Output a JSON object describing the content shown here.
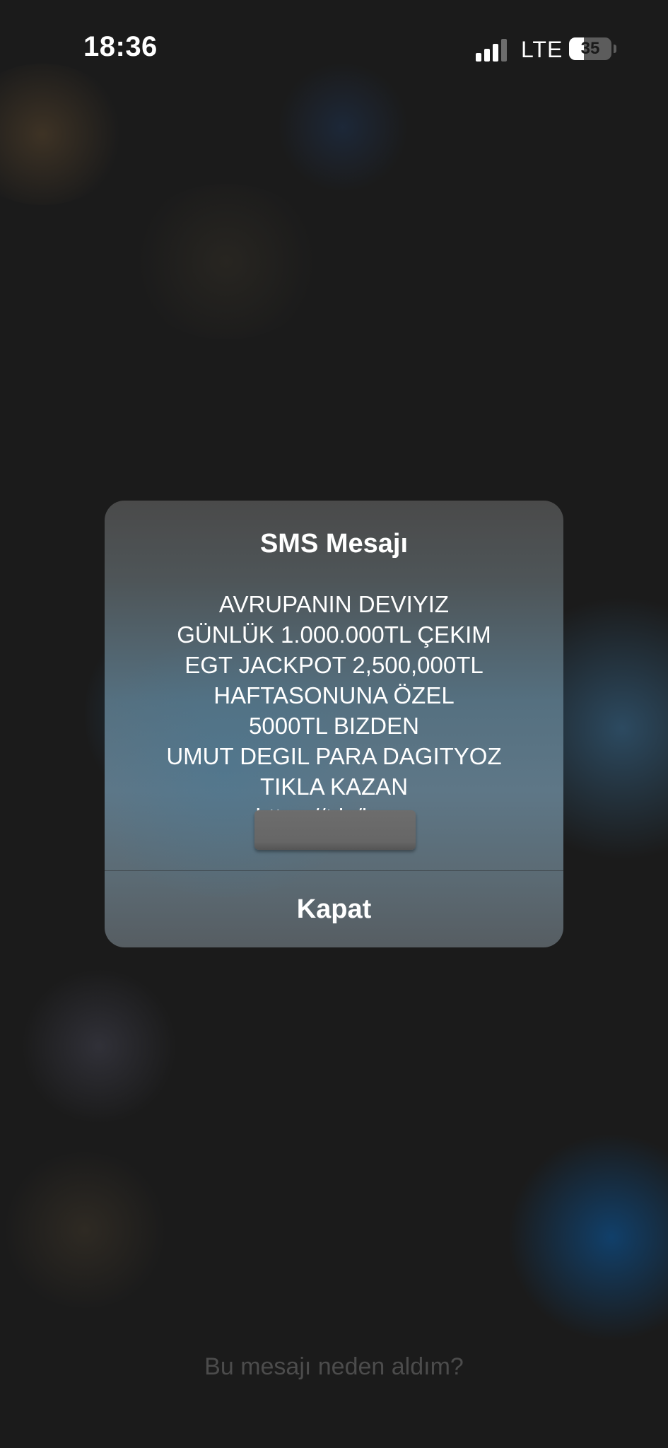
{
  "status_bar": {
    "time": "18:36",
    "network": "LTE",
    "battery_level": "35",
    "battery_fraction": 0.35,
    "signal_bars_active": 3,
    "signal_bars_total": 4
  },
  "alert": {
    "title": "SMS Mesajı",
    "message_lines": [
      "AVRUPANIN DEVIYIZ",
      "GÜNLÜK 1.000.000TL ÇEKIM",
      "EGT JACKPOT 2,500,000TL",
      "HAFTASONUNA ÖZEL",
      "5000TL BIZDEN",
      "UMUT DEGIL PARA DAGITYOZ",
      "TIKLA KAZAN",
      "https://t.ly/kung"
    ],
    "dismiss_label": "Kapat"
  },
  "footer": {
    "help_link": "Bu mesajı neden aldım?"
  }
}
